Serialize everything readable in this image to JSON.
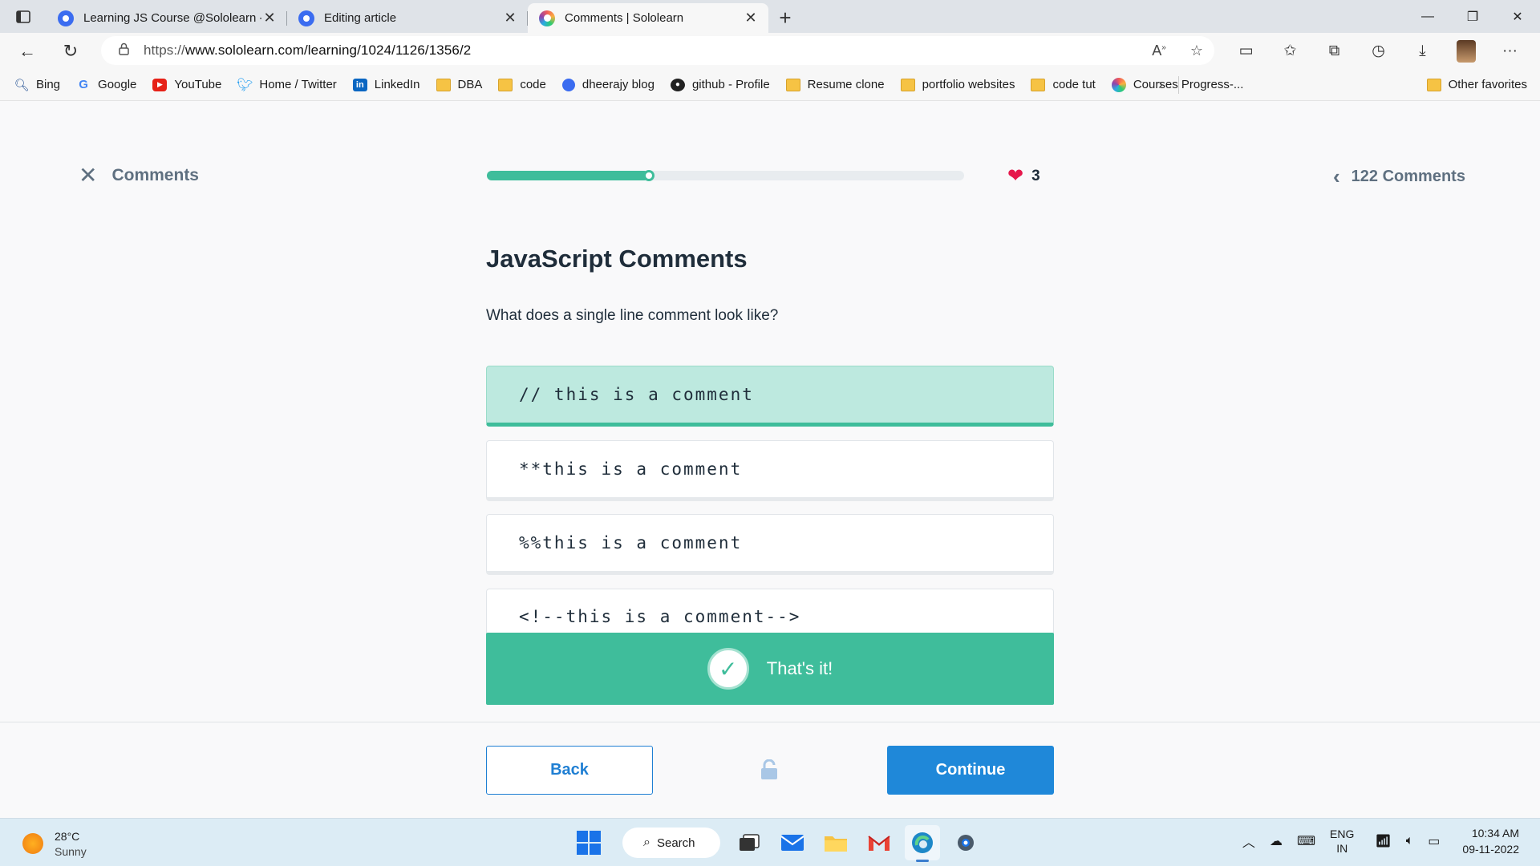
{
  "browser": {
    "tabs": [
      {
        "title": "Learning JS Course @Sololearn -",
        "favicon": "blue-circle-icon",
        "active": false
      },
      {
        "title": "Editing article",
        "favicon": "blue-circle-icon",
        "active": false
      },
      {
        "title": "Comments | Sololearn",
        "favicon": "sololearn-icon",
        "active": true
      }
    ],
    "new_tab_label": "+",
    "url_prefix": "https://",
    "url_main": "www.sololearn.com/learning/1024/1126/1356/2",
    "favorites": [
      {
        "label": "Bing",
        "icon": "search-icon"
      },
      {
        "label": "Google",
        "icon": "google-icon"
      },
      {
        "label": "YouTube",
        "icon": "youtube-icon"
      },
      {
        "label": "Home / Twitter",
        "icon": "twitter-icon"
      },
      {
        "label": "LinkedIn",
        "icon": "linkedin-icon"
      },
      {
        "label": "DBA",
        "icon": "folder-icon"
      },
      {
        "label": "code",
        "icon": "folder-icon"
      },
      {
        "label": "dheerajy blog",
        "icon": "blue-circle-icon"
      },
      {
        "label": "github - Profile",
        "icon": "github-icon"
      },
      {
        "label": "Resume clone",
        "icon": "folder-icon"
      },
      {
        "label": "portfolio websites",
        "icon": "folder-icon"
      },
      {
        "label": "code tut",
        "icon": "folder-icon"
      },
      {
        "label": "Courses Progress-...",
        "icon": "sololearn-icon"
      }
    ],
    "other_favorites": "Other favorites"
  },
  "lesson": {
    "close_label": "Comments",
    "progress_fraction": 0.34,
    "hearts": "3",
    "comments_link": "122 Comments",
    "title": "JavaScript Comments",
    "question": "What does a single line comment look like?",
    "options": [
      {
        "text": "// this is a comment",
        "selected": true
      },
      {
        "text": "**this is a comment",
        "selected": false
      },
      {
        "text": "%%this is a comment",
        "selected": false
      },
      {
        "text": "<!--this is a comment-->",
        "selected": false
      }
    ],
    "feedback": "That's it!",
    "back_label": "Back",
    "continue_label": "Continue"
  },
  "colors": {
    "accent_green": "#3fbd9b",
    "selected_bg": "#bde9df",
    "primary_blue": "#1f88d9",
    "heart_red": "#e6174b"
  },
  "taskbar": {
    "temperature": "28°C",
    "condition": "Sunny",
    "search_label": "Search",
    "lang_top": "ENG",
    "lang_bottom": "IN",
    "time": "10:34 AM",
    "date": "09-11-2022"
  }
}
